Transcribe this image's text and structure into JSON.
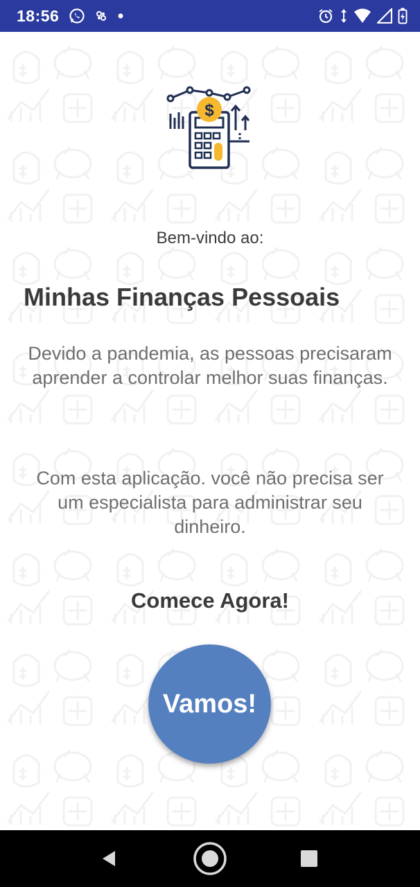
{
  "status_bar": {
    "time": "18:56",
    "left_icons": [
      "whatsapp-icon",
      "app-notification-icon",
      "dot-icon"
    ],
    "right_icons": [
      "alarm-icon",
      "data-arrows-icon",
      "wifi-icon",
      "signal-icon",
      "battery-charging-icon"
    ],
    "background_color": "#2a3a9e"
  },
  "main": {
    "logo_icon": "finance-calculator-icon",
    "welcome": "Bem-vindo ao:",
    "title": "Minhas Finanças Pessoais",
    "paragraph1": "Devido a pandemia, as pessoas precisaram aprender a controlar melhor suas finanças.",
    "paragraph2": "Com esta aplicação. você não precisa ser um especialista para administrar seu dinheiro.",
    "call_to_action": "Comece Agora!",
    "button_label": "Vamos!",
    "button_color": "#5580bf",
    "accent_color": "#f5b82e"
  },
  "nav_bar": {
    "buttons": [
      "back-icon",
      "home-icon",
      "recent-apps-icon"
    ]
  }
}
